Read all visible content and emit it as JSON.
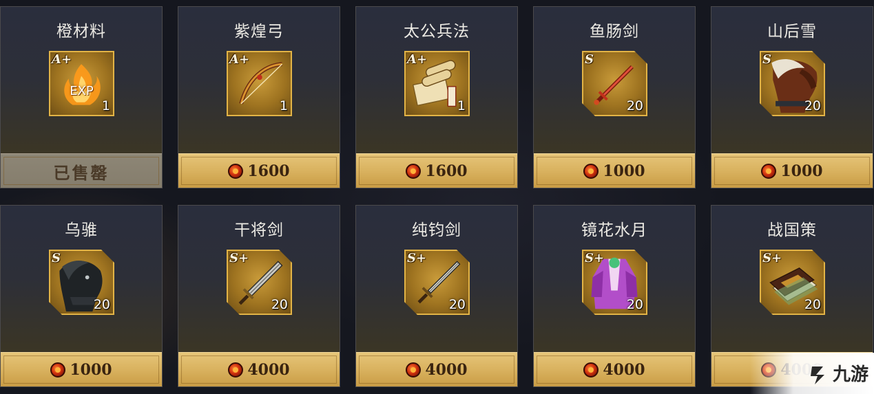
{
  "shop": {
    "items": [
      {
        "name": "橙材料",
        "grade": "A+",
        "qty": "1",
        "price": "",
        "sold": true,
        "sold_label": "已售罄",
        "art": "exp-fire-icon"
      },
      {
        "name": "紫煌弓",
        "grade": "A+",
        "qty": "1",
        "price": "1600",
        "sold": false,
        "art": "bow-icon"
      },
      {
        "name": "太公兵法",
        "grade": "A+",
        "qty": "1",
        "price": "1600",
        "sold": false,
        "art": "scroll-icon"
      },
      {
        "name": "鱼肠剑",
        "grade": "S",
        "qty": "20",
        "price": "1000",
        "sold": false,
        "art": "sword-icon"
      },
      {
        "name": "山后雪",
        "grade": "S",
        "qty": "20",
        "price": "1000",
        "sold": false,
        "art": "white-horse-icon"
      },
      {
        "name": "乌骓",
        "grade": "S",
        "qty": "20",
        "price": "1000",
        "sold": false,
        "art": "black-horse-icon"
      },
      {
        "name": "干将剑",
        "grade": "S+",
        "qty": "20",
        "price": "4000",
        "sold": false,
        "art": "sword-icon"
      },
      {
        "name": "纯钧剑",
        "grade": "S+",
        "qty": "20",
        "price": "4000",
        "sold": false,
        "art": "sword-icon"
      },
      {
        "name": "镜花水月",
        "grade": "S+",
        "qty": "20",
        "price": "4000",
        "sold": false,
        "art": "robe-icon"
      },
      {
        "name": "战国策",
        "grade": "S+",
        "qty": "20",
        "price": "4000",
        "sold": false,
        "art": "book-icon"
      }
    ]
  },
  "colors": {
    "frame_gold": "#e3b446",
    "price_bar": "#d9b25f",
    "sold_bar": "#857d6c",
    "currency_coin": "#d1320f"
  },
  "watermark": {
    "text": "九游"
  }
}
